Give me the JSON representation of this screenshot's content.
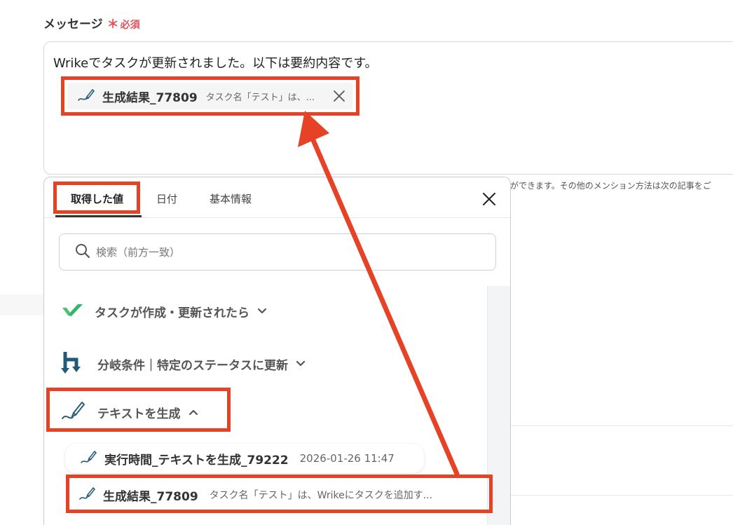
{
  "field": {
    "label": "メッセージ",
    "required_star": "＊",
    "required_text": "必須"
  },
  "message": {
    "text": "Wrikeでタスクが更新されました。以下は要約内容です。",
    "chip": {
      "title": "生成結果_77809",
      "value": "タスク名「テスト」は、..."
    }
  },
  "hint": {
    "text": "ができます。その他のメンション方法は次の記事をご"
  },
  "panel": {
    "tabs": [
      {
        "label": "取得した値"
      },
      {
        "label": "日付"
      },
      {
        "label": "基本情報"
      }
    ],
    "search_placeholder": "検索（前方一致）",
    "sections": [
      {
        "label": "タスクが作成・更新されたら",
        "icon": "wrike-check-icon"
      },
      {
        "label": "分岐条件｜特定のステータスに更新",
        "icon": "branch-icon"
      },
      {
        "label": "テキストを生成",
        "icon": "pen-icon"
      }
    ],
    "items": [
      {
        "title": "実行時間_テキストを生成_79222",
        "value": "2026-01-26 11:47"
      },
      {
        "title": "生成結果_77809",
        "value": "タスク名「テスト」は、Wrikeにタスクを追加す..."
      }
    ]
  },
  "colors": {
    "highlight": "#e64226",
    "required": "#e0505a",
    "wrike_green": "#35b865",
    "branch_blue": "#1f5a7a",
    "pen_blue": "#2b5f7a"
  }
}
